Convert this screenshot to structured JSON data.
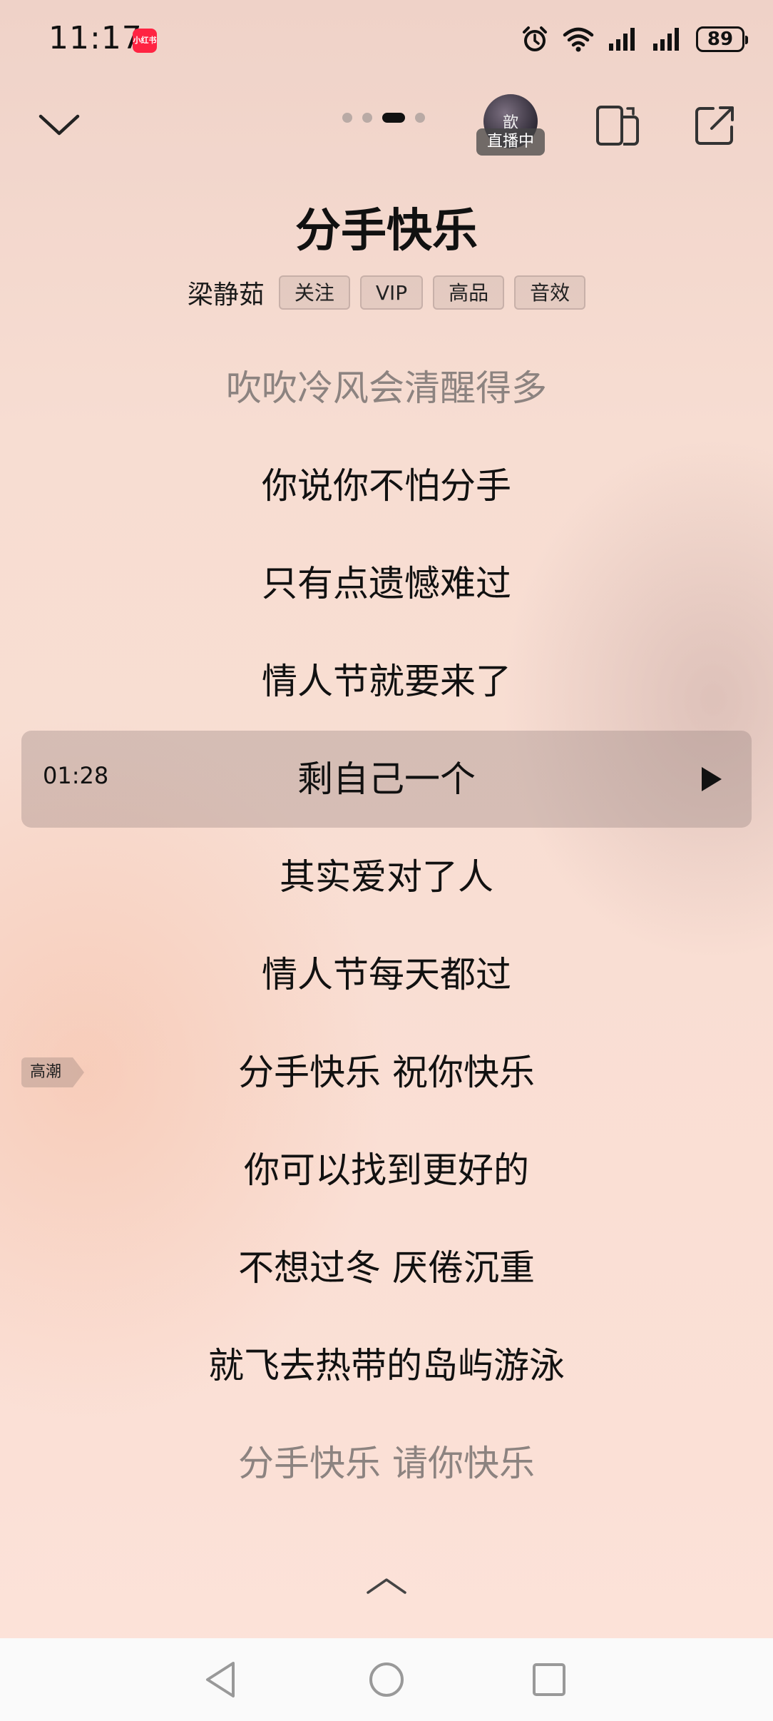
{
  "status_bar": {
    "time": "11:17",
    "app_badge": "小红书",
    "battery": "89"
  },
  "header": {
    "live_avatar_text": "歆",
    "live_badge": "直播中",
    "page_dots": {
      "count": 4,
      "active_index": 2
    }
  },
  "song": {
    "title": "分手快乐",
    "artist": "梁静茹",
    "tags": [
      "关注",
      "VIP",
      "高品",
      "音效"
    ]
  },
  "lyrics": {
    "lines": [
      {
        "text": "吹吹冷风会清醒得多",
        "dim": true
      },
      {
        "text": "你说你不怕分手",
        "dim": false
      },
      {
        "text": "只有点遗憾难过",
        "dim": false
      },
      {
        "text": "情人节就要来了",
        "dim": false
      },
      {
        "text": "剩自己一个",
        "dim": false,
        "current": true
      },
      {
        "text": "其实爱对了人",
        "dim": false
      },
      {
        "text": "情人节每天都过",
        "dim": false
      },
      {
        "text": "分手快乐 祝你快乐",
        "dim": false
      },
      {
        "text": "你可以找到更好的",
        "dim": false
      },
      {
        "text": "不想过冬 厌倦沉重",
        "dim": false
      },
      {
        "text": "就飞去热带的岛屿游泳",
        "dim": false
      },
      {
        "text": "分手快乐 请你快乐",
        "dim": true
      }
    ],
    "current_time": "01:28",
    "climax_label": "高潮"
  },
  "icons": {
    "collapse": "chevron-down-icon",
    "screen_cast": "device-switch-icon",
    "share": "share-icon",
    "play": "play-icon",
    "expand": "chevron-up-icon",
    "nav_back": "back-triangle-icon",
    "nav_home": "home-circle-icon",
    "nav_recents": "recents-square-icon"
  }
}
